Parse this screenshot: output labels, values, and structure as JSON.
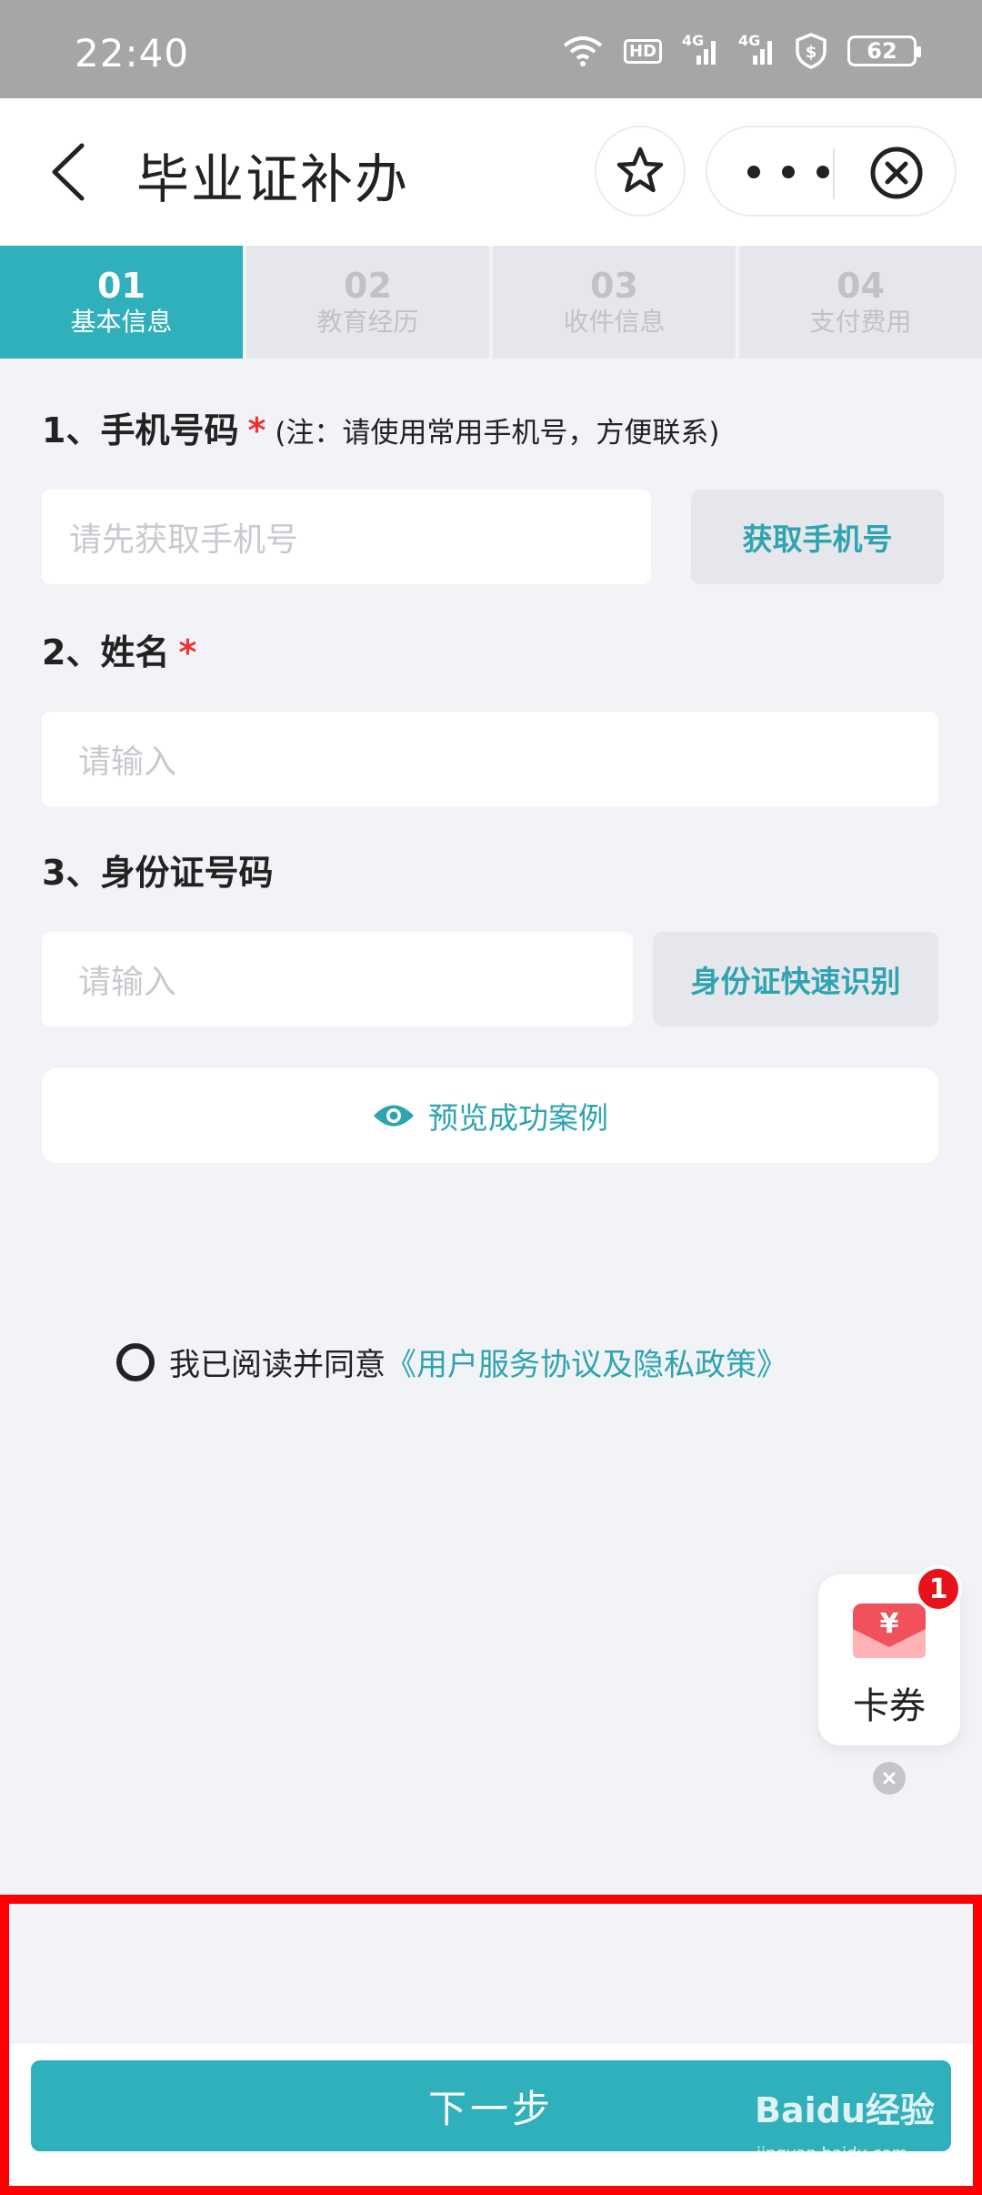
{
  "status_bar": {
    "time": "22:40",
    "battery": "62",
    "network_1": "4G",
    "network_2": "4G",
    "hd": "HD"
  },
  "nav": {
    "title": "毕业证补办"
  },
  "steps": [
    {
      "num": "01",
      "label": "基本信息"
    },
    {
      "num": "02",
      "label": "教育经历"
    },
    {
      "num": "03",
      "label": "收件信息"
    },
    {
      "num": "04",
      "label": "支付费用"
    }
  ],
  "form": {
    "phone": {
      "label": "1、手机号码",
      "required": "*",
      "note": "(注：请使用常用手机号，方便联系)",
      "placeholder": "请先获取手机号",
      "button": "获取手机号"
    },
    "name": {
      "label": "2、姓名",
      "required": "*",
      "placeholder": "请输入"
    },
    "id_number": {
      "label": "3、身份证号码",
      "placeholder": "请输入",
      "button": "身份证快速识别"
    },
    "preview": "预览成功案例"
  },
  "agreement": {
    "text": "我已阅读并同意",
    "link": "《用户服务协议及隐私政策》"
  },
  "coupon": {
    "label": "卡券",
    "badge": "1",
    "symbol": "¥"
  },
  "footer": {
    "next": "下一步"
  },
  "watermark": {
    "brand": "Baidu经验",
    "url": "jingyan.baidu.com"
  },
  "colors": {
    "accent": "#2fb0bb",
    "link": "#2ea4b0",
    "required": "#e33333",
    "badge": "#e8121a",
    "highlight": "#ff0000"
  }
}
